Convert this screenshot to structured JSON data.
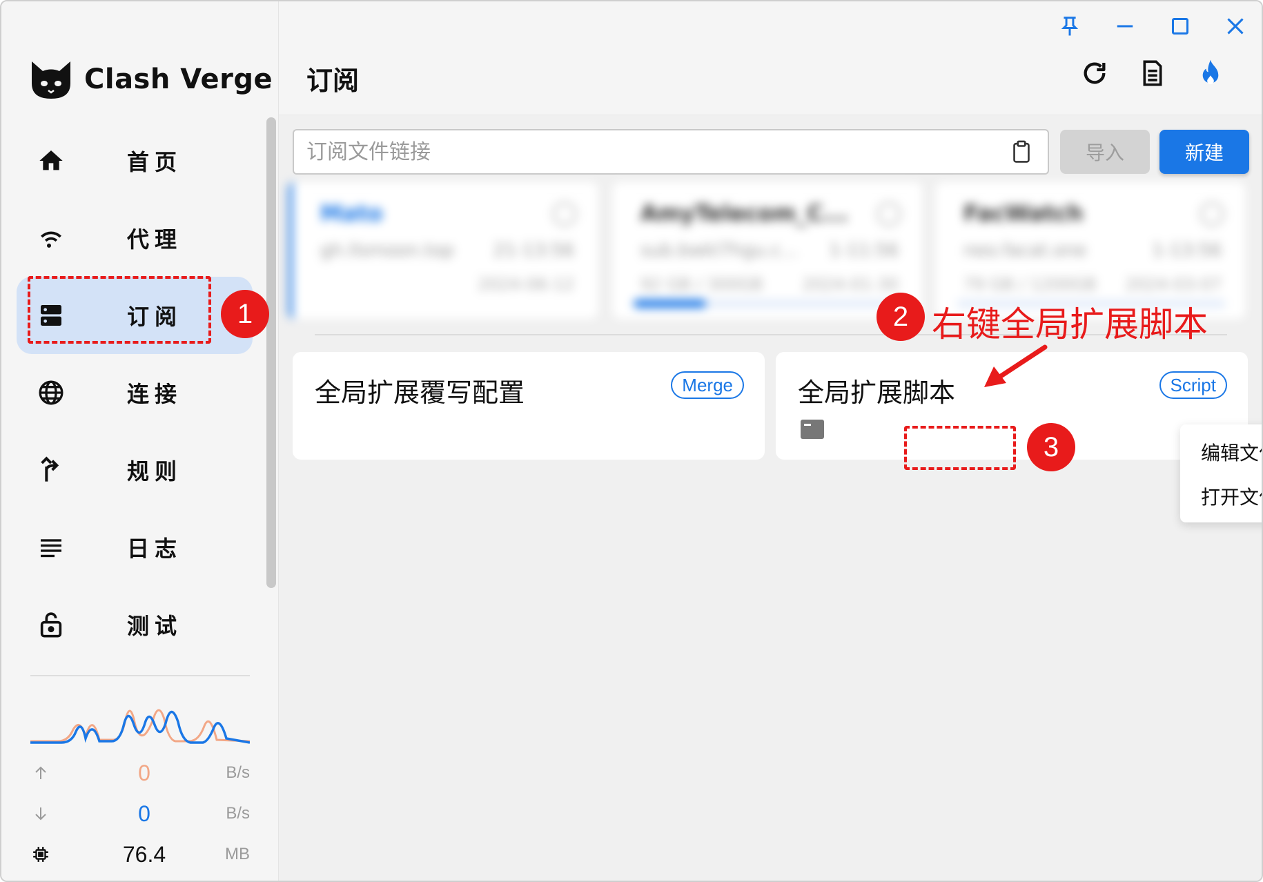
{
  "app": {
    "name": "Clash Verge",
    "page_title": "订阅"
  },
  "window_controls": [
    "pin-icon",
    "minimize-icon",
    "maximize-icon",
    "close-icon"
  ],
  "toolbar": [
    "refresh-icon",
    "log-file-icon",
    "fire-icon"
  ],
  "sidebar": {
    "items": [
      {
        "label": "首页",
        "icon": "home-icon"
      },
      {
        "label": "代理",
        "icon": "wifi-icon"
      },
      {
        "label": "订阅",
        "icon": "server-icon",
        "active": true
      },
      {
        "label": "连接",
        "icon": "globe-icon"
      },
      {
        "label": "规则",
        "icon": "fork-icon"
      },
      {
        "label": "日志",
        "icon": "list-icon"
      },
      {
        "label": "测试",
        "icon": "lock-icon"
      }
    ],
    "traffic": {
      "upload": {
        "value": "0",
        "unit": "B/s"
      },
      "download": {
        "value": "0",
        "unit": "B/s"
      },
      "memory": {
        "value": "76.4",
        "unit": "MB"
      }
    }
  },
  "subscription": {
    "url_placeholder": "订阅文件链接",
    "import_label": "导入",
    "new_label": "新建"
  },
  "profiles": [
    {
      "title": "Mato",
      "line1": "gh.llsmoon.top",
      "line1r": "21-13:56",
      "line2": "",
      "line2r": "2024-06-12",
      "progress": 0,
      "selected": true
    },
    {
      "title": "AmyTelecom_C...",
      "line1": "sub.bwkl7hgu.c...",
      "line1r": "1-11:56",
      "line2": "92 GB / 300GB",
      "line2r": "2024-01-30",
      "progress": 0.27
    },
    {
      "title": "FacWatch",
      "line1": "neo.facat.one",
      "line1r": "1-13:56",
      "line2": "79 GB / 1200GB",
      "line2r": "2024-03-07",
      "progress": 0
    }
  ],
  "enhance": [
    {
      "title": "全局扩展覆写配置",
      "tag": "Merge"
    },
    {
      "title": "全局扩展脚本",
      "tag": "Script"
    }
  ],
  "context_menu": {
    "items": [
      "编辑文件",
      "打开文件"
    ]
  },
  "annotations": {
    "step1": "1",
    "step2": "2",
    "step2_text": "右键全局扩展脚本",
    "step3": "3",
    "color": "#e81b1b"
  },
  "colors": {
    "accent": "#1a77e6",
    "active_nav_bg": "#d3e2f7",
    "annotation": "#e81b1b"
  }
}
